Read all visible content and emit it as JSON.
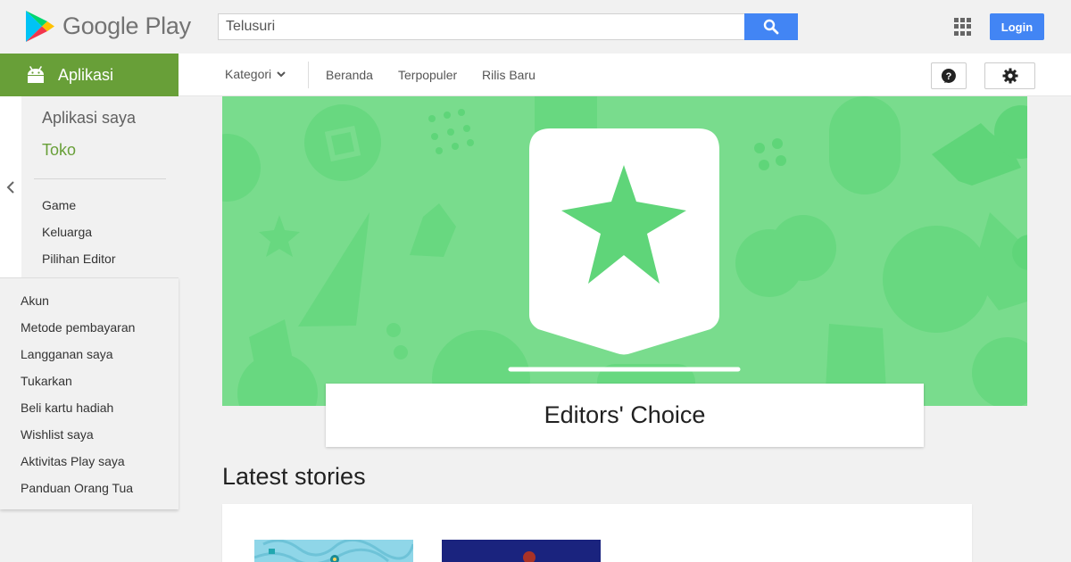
{
  "header": {
    "logo_text": "Google Play",
    "search_placeholder": "Telusuri",
    "login_label": "Login",
    "icons": [
      "google-play-logo",
      "search-icon",
      "apps-grid-icon"
    ]
  },
  "nav": {
    "category_label": "Kategori",
    "links": [
      "Beranda",
      "Terpopuler",
      "Rilis Baru"
    ],
    "icons": [
      "chevron-down-icon",
      "help-icon",
      "gear-icon"
    ]
  },
  "sidebar": {
    "apps_tab_label": "Aplikasi",
    "my_apps_label": "Aplikasi saya",
    "store_label": "Toko",
    "sub_items": [
      "Game",
      "Keluarga",
      "Pilihan Editor"
    ],
    "account_items": [
      "Akun",
      "Metode pembayaran",
      "Langganan saya",
      "Tukarkan",
      "Beli kartu hadiah",
      "Wishlist saya",
      "Aktivitas Play saya",
      "Panduan Orang Tua"
    ],
    "icons": [
      "android-icon",
      "chevron-left-icon"
    ]
  },
  "main": {
    "hero_title": "Editors' Choice",
    "section_title": "Latest stories",
    "colors": {
      "hero_bg": "#79dc8d",
      "shape": "#5fd579",
      "badge": "#ffffff",
      "accent": "#689f38",
      "primary": "#4285f4"
    }
  }
}
